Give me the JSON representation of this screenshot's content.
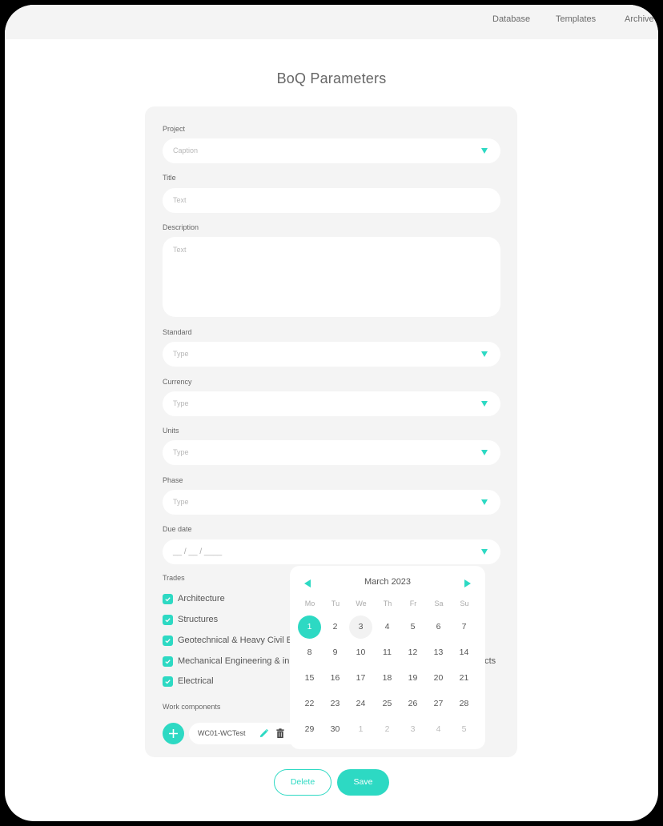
{
  "colors": {
    "accent": "#2dd9c3",
    "card_bg": "#f4f4f4",
    "frame_border": "#000000"
  },
  "nav": {
    "items": [
      "Database",
      "Templates",
      "Archive"
    ]
  },
  "page": {
    "title": "BoQ Parameters"
  },
  "form": {
    "project": {
      "label": "Project",
      "placeholder": "Caption"
    },
    "title": {
      "label": "Title",
      "placeholder": "Text"
    },
    "description": {
      "label": "Description",
      "placeholder": "Text"
    },
    "standard": {
      "label": "Standard",
      "placeholder": "Type"
    },
    "currency": {
      "label": "Currency",
      "placeholder": "Type"
    },
    "units": {
      "label": "Units",
      "placeholder": "Type"
    },
    "phase": {
      "label": "Phase",
      "placeholder": "Type"
    },
    "due_date": {
      "label": "Due date",
      "placeholder": "__ / __ / ____"
    },
    "trades": {
      "label": "Trades",
      "items": [
        {
          "label": "Architecture",
          "checked": true
        },
        {
          "label": "Structures",
          "checked": true
        },
        {
          "label": "Geotechnical & Heavy Civil E",
          "checked": true
        },
        {
          "label": "Mechanical Engineering & in",
          "checked": true
        },
        {
          "label": "Electrical",
          "checked": true
        }
      ],
      "overflow_text": "acts"
    },
    "work_components": {
      "label": "Work components",
      "items": [
        {
          "name": "WC01-WCTest"
        }
      ]
    }
  },
  "calendar": {
    "month_label": "March 2023",
    "weekdays": [
      "Mo",
      "Tu",
      "We",
      "Th",
      "Fr",
      "Sa",
      "Su"
    ],
    "weeks": [
      [
        {
          "d": "1",
          "s": "selected"
        },
        {
          "d": "2"
        },
        {
          "d": "3",
          "s": "hover"
        },
        {
          "d": "4"
        },
        {
          "d": "5"
        },
        {
          "d": "6"
        },
        {
          "d": "7"
        }
      ],
      [
        {
          "d": "8"
        },
        {
          "d": "9"
        },
        {
          "d": "10"
        },
        {
          "d": "11"
        },
        {
          "d": "12"
        },
        {
          "d": "13"
        },
        {
          "d": "14"
        }
      ],
      [
        {
          "d": "15"
        },
        {
          "d": "16"
        },
        {
          "d": "17"
        },
        {
          "d": "18"
        },
        {
          "d": "19"
        },
        {
          "d": "20"
        },
        {
          "d": "21"
        }
      ],
      [
        {
          "d": "22"
        },
        {
          "d": "23"
        },
        {
          "d": "24"
        },
        {
          "d": "25"
        },
        {
          "d": "26"
        },
        {
          "d": "27"
        },
        {
          "d": "28"
        }
      ],
      [
        {
          "d": "29"
        },
        {
          "d": "30"
        },
        {
          "d": "1",
          "s": "muted"
        },
        {
          "d": "2",
          "s": "muted"
        },
        {
          "d": "3",
          "s": "muted"
        },
        {
          "d": "4",
          "s": "muted"
        },
        {
          "d": "5",
          "s": "muted"
        }
      ]
    ]
  },
  "actions": {
    "delete_label": "Delete",
    "save_label": "Save"
  }
}
